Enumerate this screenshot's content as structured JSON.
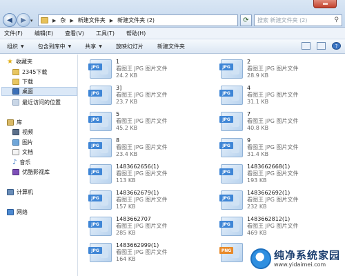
{
  "address": {
    "crumbs": [
      "杂",
      "新建文件夹",
      "新建文件夹 (2)"
    ],
    "search_placeholder": "搜索 新建文件夹 (2)"
  },
  "menu": [
    "文件(F)",
    "编辑(E)",
    "查看(V)",
    "工具(T)",
    "帮助(H)"
  ],
  "toolbar": {
    "organize": "组织",
    "include_library": "包含到库中",
    "share": "共享",
    "slideshow": "放映幻灯片",
    "new_folder": "新建文件夹"
  },
  "sidebar": {
    "favorites": "收藏夹",
    "downloads2345": "2345下载",
    "downloads": "下载",
    "desktop": "桌面",
    "recent": "最近访问的位置",
    "libraries": "库",
    "videos": "视频",
    "pictures": "图片",
    "documents": "文档",
    "music": "音乐",
    "media_library": "优酷影视库",
    "computer": "计算机",
    "network": "网络"
  },
  "files": [
    {
      "name": "1",
      "type": "看图王 JPG 图片文件",
      "size": "24.2 KB",
      "ext": "JPG"
    },
    {
      "name": "2",
      "type": "看图王 JPG 图片文件",
      "size": "28.9 KB",
      "ext": "JPG"
    },
    {
      "name": "3]",
      "type": "看图王 JPG 图片文件",
      "size": "23.7 KB",
      "ext": "JPG"
    },
    {
      "name": "4",
      "type": "看图王 JPG 图片文件",
      "size": "31.1 KB",
      "ext": "JPG"
    },
    {
      "name": "5",
      "type": "看图王 JPG 图片文件",
      "size": "45.2 KB",
      "ext": "JPG"
    },
    {
      "name": "7",
      "type": "看图王 JPG 图片文件",
      "size": "40.8 KB",
      "ext": "JPG"
    },
    {
      "name": "8",
      "type": "看图王 JPG 图片文件",
      "size": "23.4 KB",
      "ext": "JPG"
    },
    {
      "name": "9",
      "type": "看图王 JPG 图片文件",
      "size": "31.4 KB",
      "ext": "JPG"
    },
    {
      "name": "1483662656(1)",
      "type": "看图王 JPG 图片文件",
      "size": "113 KB",
      "ext": "JPG"
    },
    {
      "name": "1483662668(1)",
      "type": "看图王 JPG 图片文件",
      "size": "193 KB",
      "ext": "JPG"
    },
    {
      "name": "1483662679(1)",
      "type": "看图王 JPG 图片文件",
      "size": "157 KB",
      "ext": "JPG"
    },
    {
      "name": "1483662692(1)",
      "type": "看图王 JPG 图片文件",
      "size": "232 KB",
      "ext": "JPG"
    },
    {
      "name": "1483662707",
      "type": "看图王 JPG 图片文件",
      "size": "285 KB",
      "ext": "JPG"
    },
    {
      "name": "1483662812(1)",
      "type": "看图王 JPG 图片文件",
      "size": "469 KB",
      "ext": "JPG"
    },
    {
      "name": "1483662999(1)",
      "type": "看图王 JPG 图片文件",
      "size": "164 KB",
      "ext": "JPG"
    },
    {
      "name": "",
      "type": "",
      "size": "",
      "ext": "PNG"
    }
  ],
  "watermark": {
    "title": "纯净系统家园",
    "url": "www.yidaimei.com"
  }
}
